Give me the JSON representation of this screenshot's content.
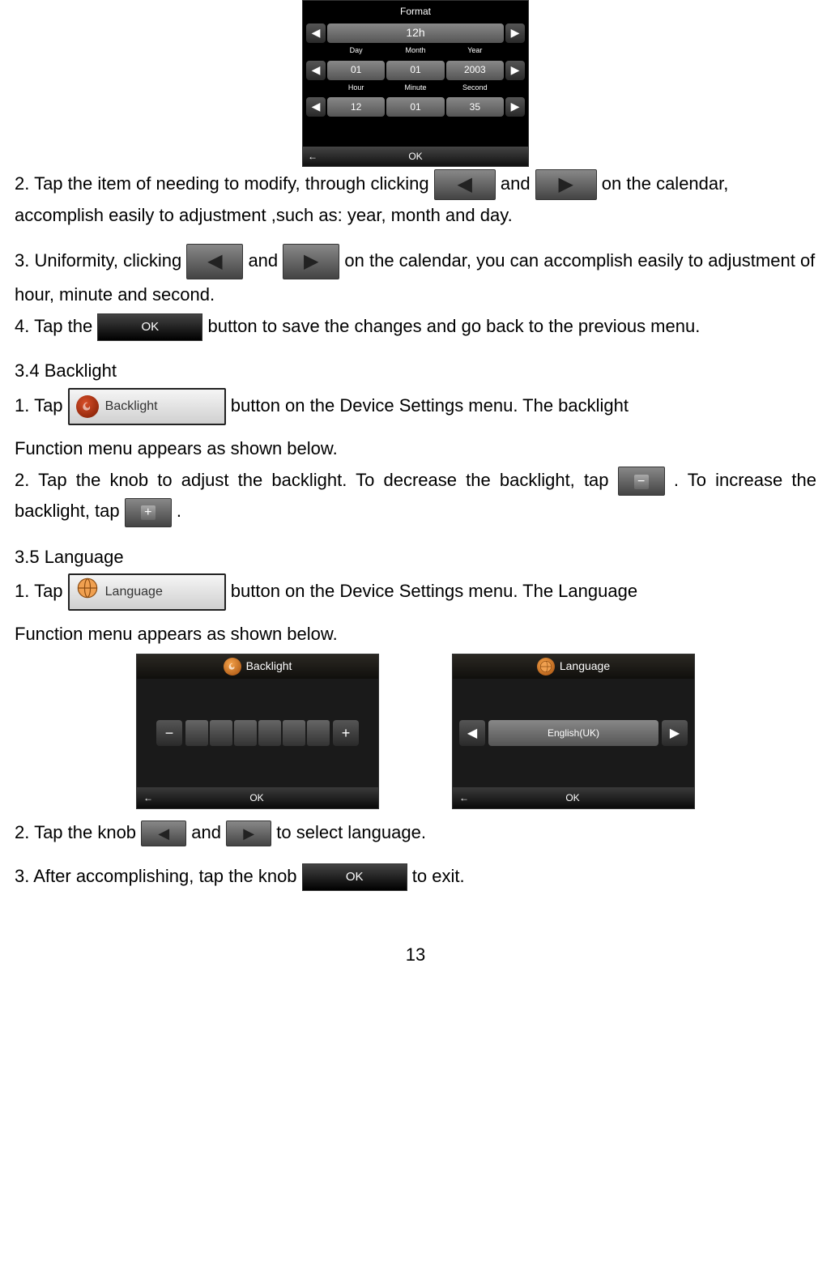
{
  "format_screenshot": {
    "title": "Format",
    "format_value": "12h",
    "date_labels": [
      "Day",
      "Month",
      "Year"
    ],
    "date_values": [
      "01",
      "01",
      "2003"
    ],
    "time_labels": [
      "Hour",
      "Minute",
      "Second"
    ],
    "time_values": [
      "12",
      "01",
      "35"
    ],
    "ok_label": "OK"
  },
  "step2": {
    "pre": "2. Tap the item of needing to modify, through clicking ",
    "mid": " and ",
    "post": " on the calendar, accomplish easily to adjustment ,such as: year, month and day."
  },
  "step3": {
    "pre": "3. Uniformity, clicking ",
    "mid": " and ",
    "post": " on the calendar, you can accomplish easily to adjustment of hour, minute and second."
  },
  "step4": {
    "pre": "4. Tap the ",
    "ok_label": "OK",
    "post": " button to save the changes and go back to the previous menu."
  },
  "section34": {
    "heading": "3.4 Backlight",
    "s1_pre": "1. Tap ",
    "backlight_btn": "Backlight",
    "s1_post": " button on the Device Settings menu. The backlight",
    "s1_cont": "Function menu appears as shown below.",
    "s2_pre": "2. Tap the knob to adjust the backlight. To decrease the backlight, tap",
    "s2_post": " . To increase the backlight, tap ",
    "s2_end": " ."
  },
  "section35": {
    "heading": "3.5 Language",
    "s1_pre": "1. Tap ",
    "language_btn": "Language",
    "s1_post": " button on the Device Settings menu. The Language",
    "s1_cont": "Function menu appears as shown below."
  },
  "backlight_shot": {
    "title": "Backlight",
    "ok_label": "OK"
  },
  "language_shot": {
    "title": "Language",
    "value": "English(UK)",
    "ok_label": "OK"
  },
  "step5": {
    "pre": "2. Tap the knob ",
    "mid": " and ",
    "post": " to select language."
  },
  "step6": {
    "pre": "3. After accomplishing, tap the knob ",
    "ok_label": "OK",
    "post": " to exit."
  },
  "page_number": "13"
}
